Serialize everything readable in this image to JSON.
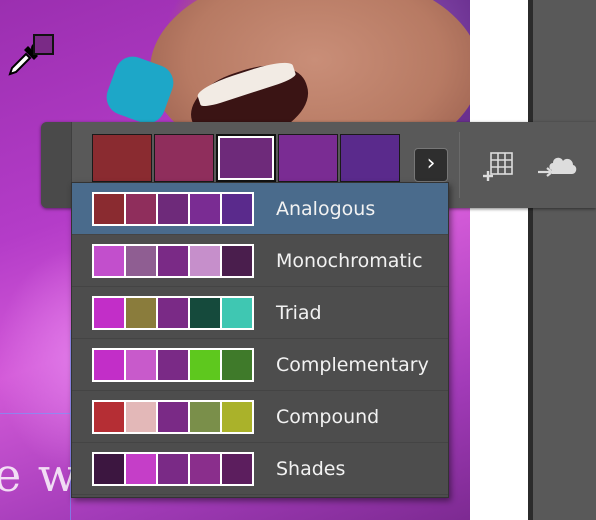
{
  "canvas": {
    "overlay_text": "e when the"
  },
  "eyedropper": {
    "icon": "eyedropper-icon",
    "sampled_color": "#7a2a86"
  },
  "theme_bar": {
    "swatches": [
      "#8a2b30",
      "#8f2e5c",
      "#6e2a7a",
      "#7a2c93",
      "#5a2a8c"
    ],
    "selected_index": 2,
    "next_icon": "chevron-right-icon",
    "next_glyph": "›",
    "add_icon": "add-swatches-icon",
    "cloud_icon": "cloud-upload-icon"
  },
  "menu": {
    "items": [
      {
        "label": "Analogous",
        "colors": [
          "#8a2b30",
          "#8f2e5c",
          "#6e2a7a",
          "#7a2c93",
          "#5a2a8c"
        ]
      },
      {
        "label": "Monochromatic",
        "colors": [
          "#c24fcc",
          "#8f5e92",
          "#7a2a86",
          "#c68fcb",
          "#4a1e4d"
        ]
      },
      {
        "label": "Triad",
        "colors": [
          "#c22ec8",
          "#8a7c3c",
          "#7a2a86",
          "#154a3c",
          "#3fc7b2"
        ]
      },
      {
        "label": "Complementary",
        "colors": [
          "#c22ec8",
          "#c85acb",
          "#7a2a86",
          "#5ec81e",
          "#3f7a2a"
        ]
      },
      {
        "label": "Compound",
        "colors": [
          "#b52e34",
          "#e3b8b8",
          "#7a2a86",
          "#7a8f4a",
          "#aab22a"
        ]
      },
      {
        "label": "Shades",
        "colors": [
          "#3c1640",
          "#c53ec8",
          "#7a2a86",
          "#8a2e8c",
          "#5c1e5e"
        ]
      }
    ],
    "active_index": 0
  }
}
